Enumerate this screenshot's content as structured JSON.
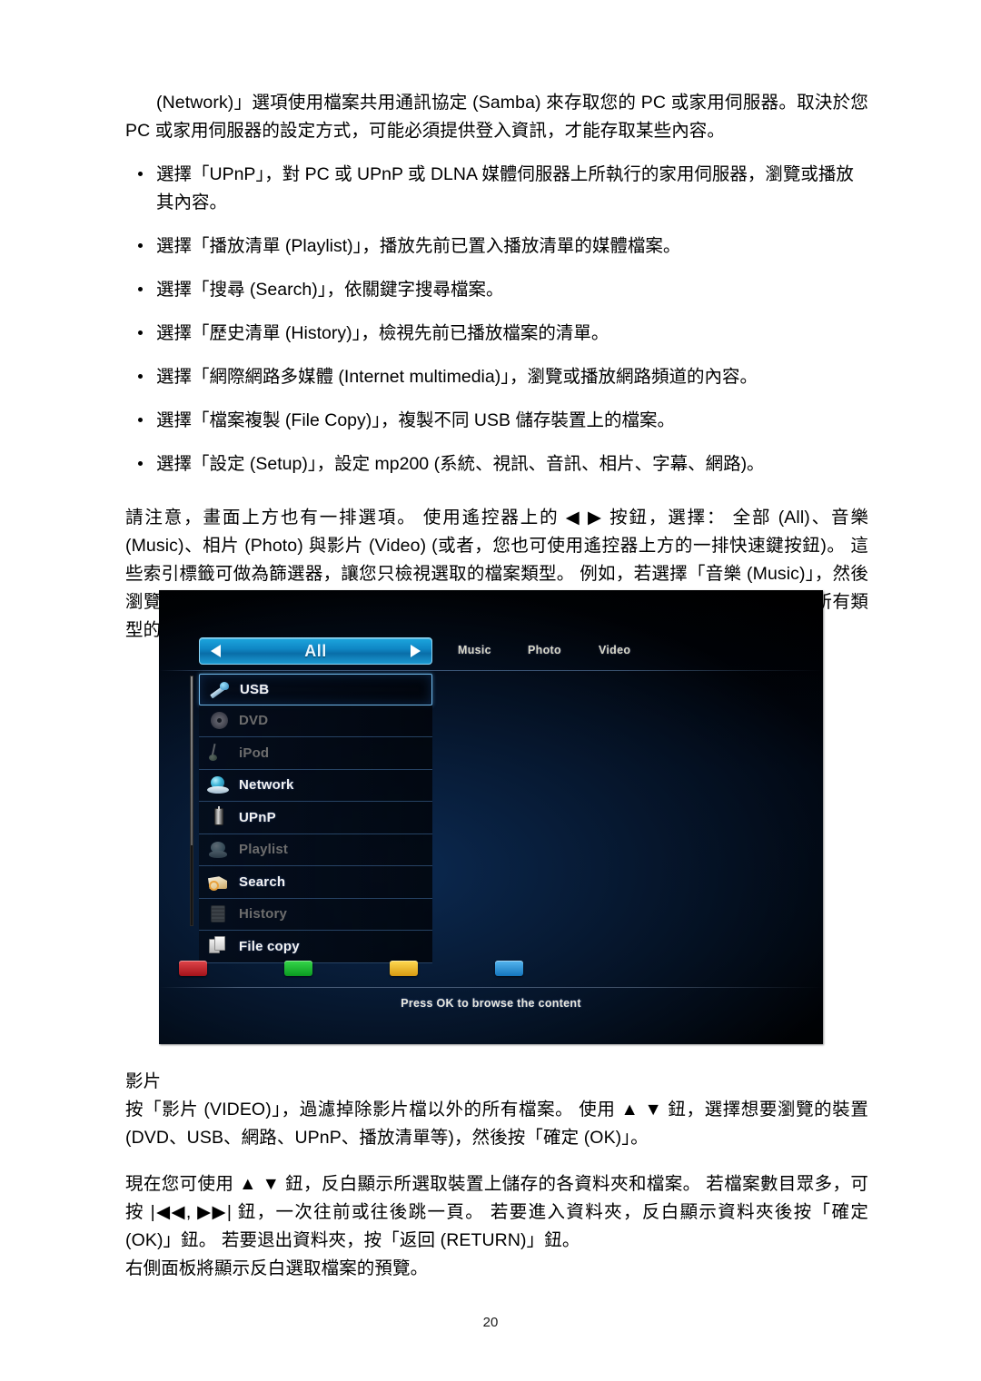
{
  "document": {
    "page_number": "20",
    "intro_paragraph": "(Network)」選項使用檔案共用通訊協定 (Samba) 來存取您的 PC 或家用伺服器。取決於您 PC 或家用伺服器的設定方式，可能必須提供登入資訊，才能存取某些內容。",
    "bullets": [
      "選擇「UPnP」，對 PC 或 UPnP 或 DLNA 媒體伺服器上所執行的家用伺服器，瀏覽或播放其內容。",
      "選擇「播放清單 (Playlist)」，播放先前已置入播放清單的媒體檔案。",
      "選擇「搜尋 (Search)」，依關鍵字搜尋檔案。",
      "選擇「歷史清單 (History)」，檢視先前已播放檔案的清單。",
      "選擇「網際網路多媒體 (Internet multimedia)」，瀏覽或播放網路頻道的內容。",
      "選擇「檔案複製 (File Copy)」，複製不同 USB 儲存裝置上的檔案。",
      "選擇「設定 (Setup)」，設定 mp200 (系統、視訊、音訊、相片、字幕、網路)。"
    ],
    "note_paragraph": "請注意，畫面上方也有一排選項。 使用遙控器上的 ◀ ▶ 按鈕，選擇： 全部 (All)、音樂 (Music)、相片 (Photo) 與影片 (Video) (或者，您也可使用遙控器上方的一排快速鍵按鈕)。 這些索引標籤可做為篩選器，讓您只檢視選取的檔案類型。 例如，若選擇「音樂 (Music)」，然後瀏覽至包含相片與音樂檔的資料夾，將只會顯示音樂檔。 若選擇「全部 (All)」，將顯示所有類型的檔案。",
    "video_heading": "影片",
    "video_paragraph": "按「影片 (VIDEO)」，過濾掉除影片檔以外的所有檔案。 使用 ▲ ▼ 鈕，選擇想要瀏覽的裝置 (DVD、USB、網路、UPnP、播放清單等)，然後按「確定 (OK)」。",
    "browse_paragraph": "現在您可使用 ▲ ▼ 鈕，反白顯示所選取裝置上儲存的各資料夾和檔案。 若檔案數目眾多，可按 |◀◀, ▶▶| 鈕，一次往前或往後跳一頁。 若要進入資料夾，反白顯示資料夾後按「確定 (OK)」鈕。 若要退出資料夾，按「返回 (RETURN)」鈕。",
    "preview_paragraph": "右側面板將顯示反白選取檔案的預覽。"
  },
  "device_screenshot": {
    "filter_tab": {
      "selected_label": "All",
      "left_arrow": "◀",
      "right_arrow": "▶",
      "other_tabs": [
        "Music",
        "Photo",
        "Video"
      ]
    },
    "menu_items": [
      {
        "label": "USB",
        "icon": "usb-icon",
        "state": "selected"
      },
      {
        "label": "DVD",
        "icon": "disc-icon",
        "state": "disabled"
      },
      {
        "label": "iPod",
        "icon": "music-note-icon",
        "state": "disabled"
      },
      {
        "label": "Network",
        "icon": "globe-icon",
        "state": "enabled"
      },
      {
        "label": "UPnP",
        "icon": "server-icon",
        "state": "enabled"
      },
      {
        "label": "Playlist",
        "icon": "playlist-icon",
        "state": "disabled"
      },
      {
        "label": "Search",
        "icon": "search-folder-icon",
        "state": "enabled"
      },
      {
        "label": "History",
        "icon": "history-icon",
        "state": "disabled"
      },
      {
        "label": "File copy",
        "icon": "copy-icon",
        "state": "enabled"
      }
    ],
    "color_keys": [
      {
        "name": "red-key",
        "color": "#c8252c"
      },
      {
        "name": "green-key",
        "color": "#17b52c"
      },
      {
        "name": "yellow-key",
        "color": "#e8b520"
      },
      {
        "name": "blue-key",
        "color": "#2e8fd0"
      }
    ],
    "status_text": "Press OK to browse the content"
  }
}
